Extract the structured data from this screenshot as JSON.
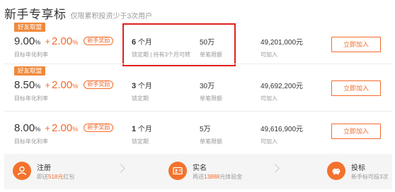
{
  "header": {
    "title": "新手专享标",
    "subtitle": "仅限累积投资少于3次用户"
  },
  "products": [
    {
      "badge": "好友取盟",
      "base_rate": "9.00",
      "pct": "%",
      "plus": "+",
      "bonus_rate": "2.00",
      "bonus_pct": "%",
      "tag": "新手奖励",
      "rate_label": "目标年化利率",
      "term_value": "6",
      "term_unit": "个月",
      "term_label": "锁定期 | 持有3个月可转",
      "limit_value": "50万",
      "limit_label": "单笔限额",
      "amount_value": "49,201,000元",
      "amount_label": "可加入",
      "join_label": "立即加入"
    },
    {
      "badge": "好友取盟",
      "base_rate": "8.50",
      "pct": "%",
      "plus": "+",
      "bonus_rate": "2.00",
      "bonus_pct": "%",
      "tag": "新手奖励",
      "rate_label": "目标年化利率",
      "term_value": "3",
      "term_unit": "个月",
      "term_label": "锁定期",
      "limit_value": "30万",
      "limit_label": "单笔限额",
      "amount_value": "49,692,200元",
      "amount_label": "可加入",
      "join_label": "立即加入"
    },
    {
      "badge": "",
      "base_rate": "8.00",
      "pct": "%",
      "plus": "+",
      "bonus_rate": "2.00",
      "bonus_pct": "%",
      "tag": "新手奖励",
      "rate_label": "目标年化利率",
      "term_value": "1",
      "term_unit": "个月",
      "term_label": "锁定期",
      "limit_value": "5万",
      "limit_label": "单笔限额",
      "amount_value": "49,616,900元",
      "amount_label": "可加入",
      "join_label": "立即加入"
    }
  ],
  "footer": {
    "register": {
      "title": "注册",
      "desc_pre": "即送",
      "desc_hl": "518元",
      "desc_post": "红包",
      "icon": "user-icon"
    },
    "verify": {
      "title": "实名",
      "desc_pre": "再送",
      "desc_hl": "13888",
      "desc_post": "元体验金",
      "icon": "id-card-icon"
    },
    "invest": {
      "title": "投标",
      "desc": "新手标可投3次",
      "icon": "piggy-bank-icon"
    }
  },
  "colors": {
    "accent": "#f36b2b",
    "badge": "#f08a3c",
    "highlight_border": "#e0211b",
    "footer_bg": "#f5f5f5"
  }
}
